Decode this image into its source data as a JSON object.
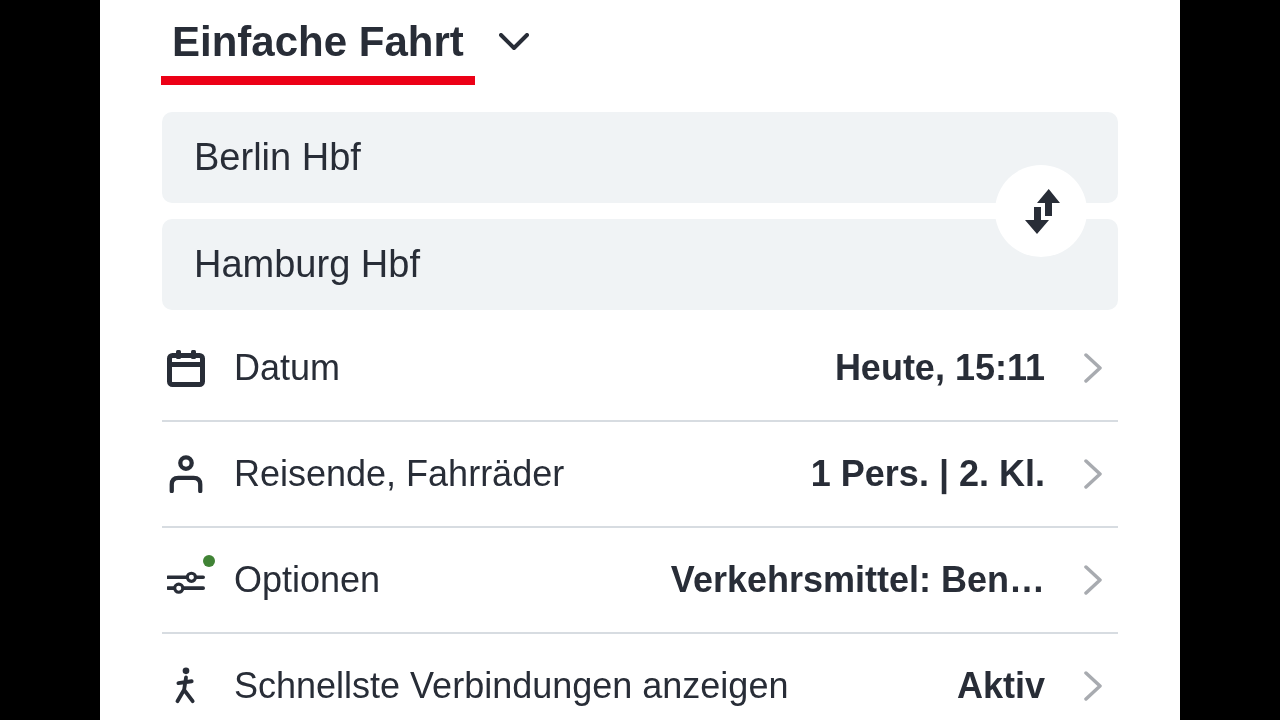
{
  "trip_tab": {
    "label": "Einfache Fahrt",
    "selected": true
  },
  "route": {
    "origin": {
      "value": "Berlin Hbf"
    },
    "destination": {
      "value": "Hamburg Hbf"
    }
  },
  "rows": [
    {
      "kind": "date",
      "label": "Datum",
      "value": "Heute, 15:11",
      "badge": false
    },
    {
      "kind": "travelers",
      "label": "Reisende, Fahrräder",
      "value": "1 Pers. | 2. Kl.",
      "badge": false
    },
    {
      "kind": "options",
      "label": "Optionen",
      "value": "Verkehrsmittel: Ben…",
      "badge": true
    },
    {
      "kind": "fastest",
      "label": "Schnellste Verbindungen anzeigen",
      "value": "Aktiv",
      "badge": false
    }
  ]
}
